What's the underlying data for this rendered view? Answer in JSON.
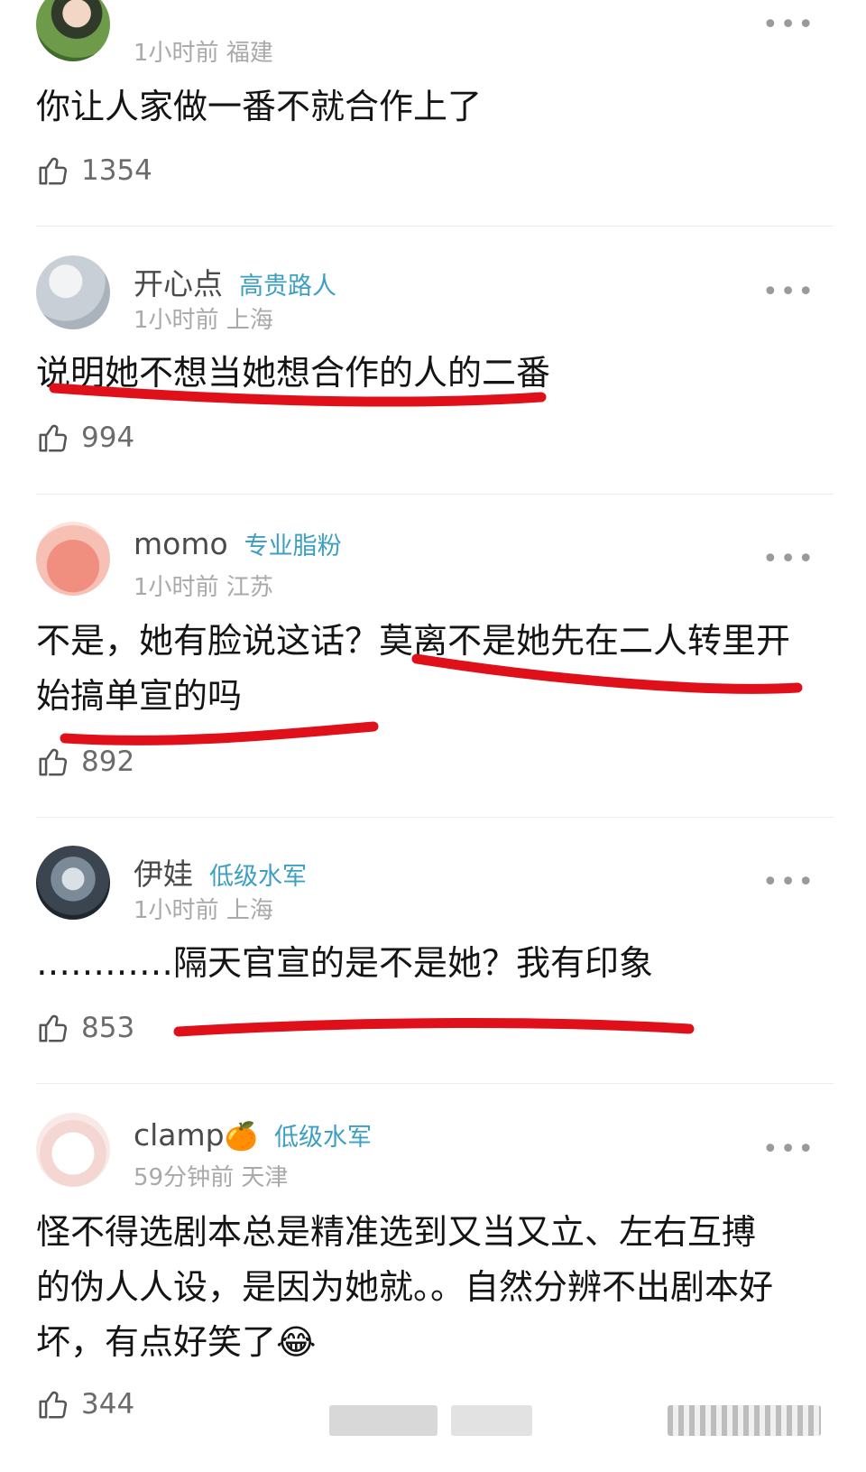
{
  "comments": [
    {
      "name": "",
      "badge": "",
      "time": "1小时前",
      "location": "福建",
      "text": "你让人家做一番不就合作上了",
      "likes": "1354",
      "avatar_icon": "avatar-girl-portrait"
    },
    {
      "name": "开心点",
      "badge": "高贵路人",
      "time": "1小时前",
      "location": "上海",
      "text": "说明她不想当她想合作的人的二番",
      "likes": "994",
      "avatar_icon": "avatar-cloudy-sky"
    },
    {
      "name": "momo",
      "badge": "专业脂粉",
      "time": "1小时前",
      "location": "江苏",
      "text": "不是，她有脸说这话？莫离不是她先在二人转里开始搞单宣的吗",
      "likes": "892",
      "avatar_icon": "avatar-red-cartoon"
    },
    {
      "name": "伊娃",
      "badge": "低级水军",
      "time": "1小时前",
      "location": "上海",
      "text": "…………隔天官宣的是不是她？我有印象",
      "likes": "853",
      "avatar_icon": "avatar-toy-figure"
    },
    {
      "name": "clamp",
      "name_emoji": "🍊",
      "badge": "低级水军",
      "time": "59分钟前",
      "location": "天津",
      "text": "怪不得选剧本总是精准选到又当又立、左右互搏的伪人人设，是因为她就。。自然分辨不出剧本好坏，有点好笑了😂",
      "likes": "344",
      "avatar_icon": "avatar-cute-face"
    }
  ],
  "more_icon": "more-dots-icon",
  "like_icon": "thumbs-up-icon",
  "annotation_color": "#e0101a"
}
